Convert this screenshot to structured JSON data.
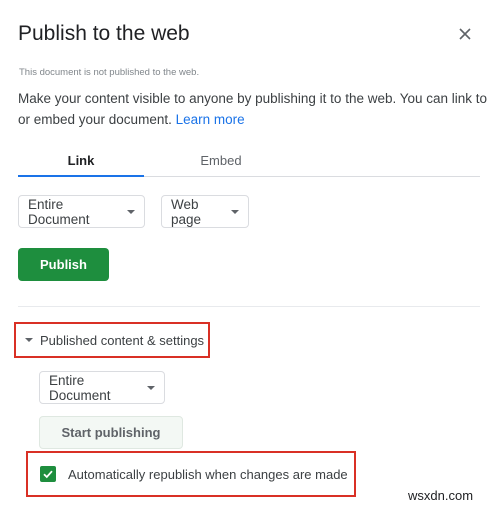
{
  "dialog": {
    "title": "Publish to the web",
    "close_icon": "close-icon",
    "status": "This document is not published to the web.",
    "description": "Make your content visible to anyone by publishing it to the web. You can link to or embed your document.",
    "learn_more": "Learn more"
  },
  "tabs": [
    {
      "label": "Link",
      "active": true
    },
    {
      "label": "Embed",
      "active": false
    }
  ],
  "link": {
    "scope_select": "Entire Document",
    "format_select": "Web page",
    "publish_button": "Publish"
  },
  "published_settings": {
    "section_label": "Published content & settings",
    "expanded": true,
    "scope_select": "Entire Document",
    "start_publishing_button": "Start publishing",
    "auto_republish_label": "Automatically republish when changes are made",
    "auto_republish_checked": true
  },
  "colors": {
    "accent_blue": "#1a73e8",
    "publish_green": "#1e8e3e",
    "highlight_red": "#d93025"
  },
  "watermark": "wsxdn.com"
}
